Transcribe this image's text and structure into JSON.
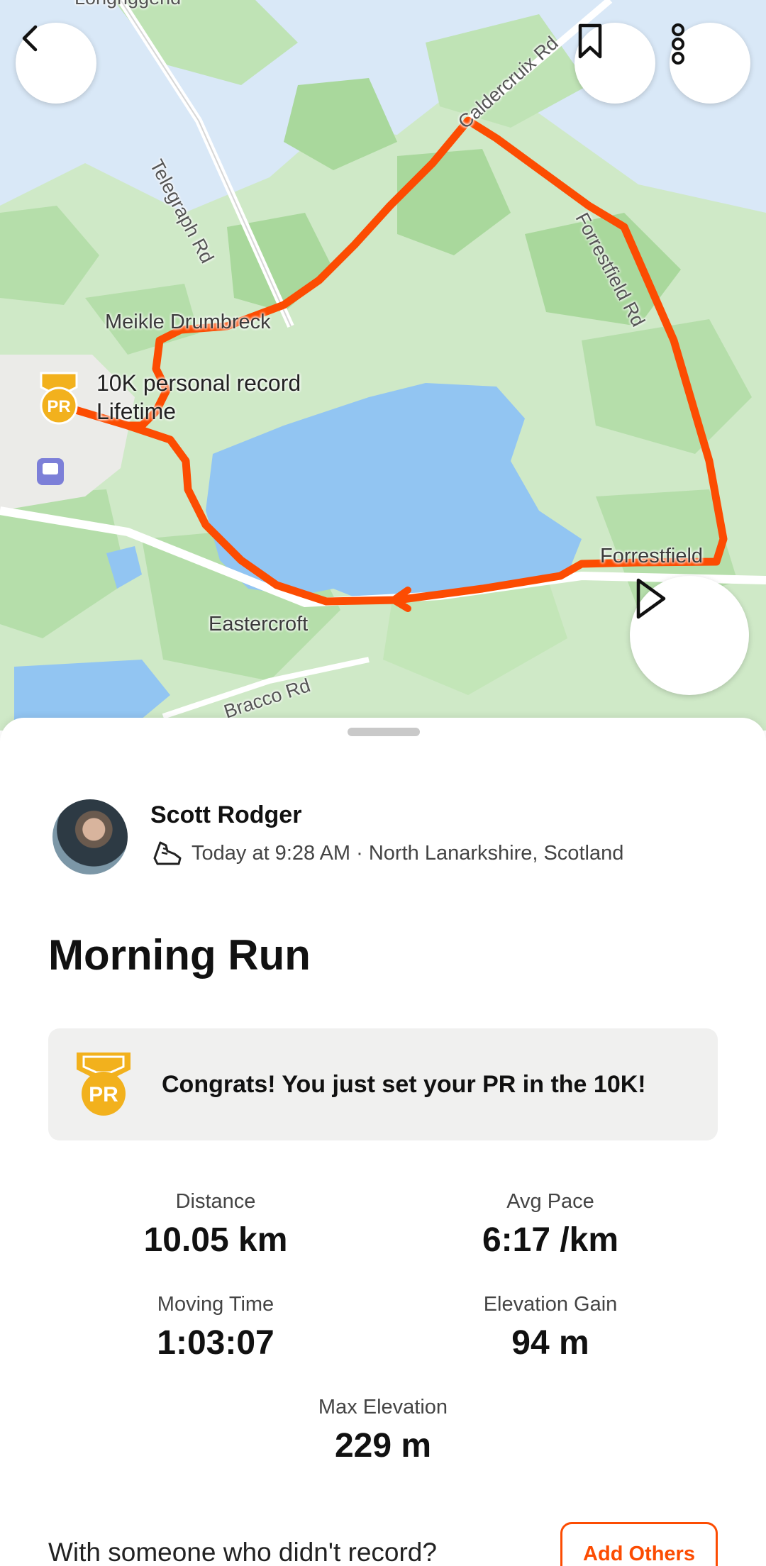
{
  "map": {
    "labels": {
      "caldercruix_rd": "Caldercruix Rd",
      "telegraph_rd": "Telegraph Rd",
      "forrestfield_rd": "Forrestfield Rd",
      "meikle_drumbreck": "Meikle Drumbreck",
      "pr_line1": "10K personal record",
      "pr_line2": "Lifetime",
      "forrestfield": "Forrestfield",
      "eastercroft": "Eastercroft",
      "bracco_rd": "Bracco Rd",
      "top_cut": "Longriggend"
    },
    "pr_badge_text": "PR",
    "route_color": "#fc4c02"
  },
  "buttons": {
    "back": "back-icon",
    "bookmark": "bookmark-icon",
    "more": "more-vertical-icon",
    "play": "play-icon"
  },
  "athlete": {
    "name": "Scott Rodger",
    "meta": "Today at 9:28 AM · North Lanarkshire, Scotland",
    "activity_icon": "run-shoe-icon"
  },
  "activity": {
    "title": "Morning Run"
  },
  "pr_banner": {
    "badge_text": "PR",
    "message": "Congrats! You just set your PR in the 10K!"
  },
  "stats": {
    "distance": {
      "label": "Distance",
      "value": "10.05 km"
    },
    "avg_pace": {
      "label": "Avg Pace",
      "value": "6:17 /km"
    },
    "moving_time": {
      "label": "Moving Time",
      "value": "1:03:07"
    },
    "elevation_gain": {
      "label": "Elevation Gain",
      "value": "94 m"
    },
    "max_elevation": {
      "label": "Max Elevation",
      "value": "229 m"
    }
  },
  "footer": {
    "with_others": "With someone who didn't record?",
    "add_others": "Add Others"
  },
  "colors": {
    "accent": "#fc4c02",
    "pr_gold": "#f2b11d"
  }
}
